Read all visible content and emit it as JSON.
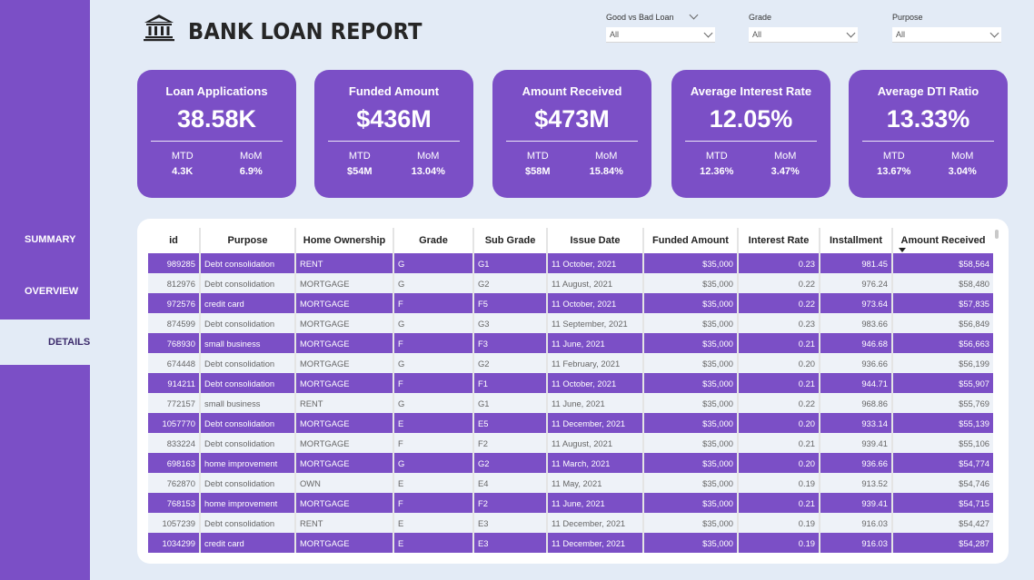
{
  "sidebar": {
    "items": [
      {
        "label": "SUMMARY"
      },
      {
        "label": "OVERVIEW"
      },
      {
        "label": "DETAILS"
      }
    ]
  },
  "header": {
    "title": "BANK LOAN REPORT",
    "icon": "bank-icon"
  },
  "filters": [
    {
      "label": "Good vs Bad Loan",
      "value": "All"
    },
    {
      "label": "Grade",
      "value": "All"
    },
    {
      "label": "Purpose",
      "value": "All"
    }
  ],
  "kpis": [
    {
      "title": "Loan Applications",
      "value": "38.58K",
      "mtd_label": "MTD",
      "mtd": "4.3K",
      "mom_label": "MoM",
      "mom": "6.9%"
    },
    {
      "title": "Funded Amount",
      "value": "$436M",
      "mtd_label": "MTD",
      "mtd": "$54M",
      "mom_label": "MoM",
      "mom": "13.04%"
    },
    {
      "title": "Amount Received",
      "value": "$473M",
      "mtd_label": "MTD",
      "mtd": "$58M",
      "mom_label": "MoM",
      "mom": "15.84%"
    },
    {
      "title": "Average Interest Rate",
      "value": "12.05%",
      "mtd_label": "MTD",
      "mtd": "12.36%",
      "mom_label": "MoM",
      "mom": "3.47%"
    },
    {
      "title": "Average DTI Ratio",
      "value": "13.33%",
      "mtd_label": "MTD",
      "mtd": "13.67%",
      "mom_label": "MoM",
      "mom": "3.04%"
    }
  ],
  "table": {
    "columns": [
      "id",
      "Purpose",
      "Home Ownership",
      "Grade",
      "Sub Grade",
      "Issue Date",
      "Funded Amount",
      "Interest Rate",
      "Installment",
      "Amount Received"
    ],
    "rows": [
      [
        "989285",
        "Debt consolidation",
        "RENT",
        "G",
        "G1",
        "11 October, 2021",
        "$35,000",
        "0.23",
        "981.45",
        "$58,564"
      ],
      [
        "812976",
        "Debt consolidation",
        "MORTGAGE",
        "G",
        "G2",
        "11 August, 2021",
        "$35,000",
        "0.22",
        "976.24",
        "$58,480"
      ],
      [
        "972576",
        "credit card",
        "MORTGAGE",
        "F",
        "F5",
        "11 October, 2021",
        "$35,000",
        "0.22",
        "973.64",
        "$57,835"
      ],
      [
        "874599",
        "Debt consolidation",
        "MORTGAGE",
        "G",
        "G3",
        "11 September, 2021",
        "$35,000",
        "0.23",
        "983.66",
        "$56,849"
      ],
      [
        "768930",
        "small business",
        "MORTGAGE",
        "F",
        "F3",
        "11 June, 2021",
        "$35,000",
        "0.21",
        "946.68",
        "$56,663"
      ],
      [
        "674448",
        "Debt consolidation",
        "MORTGAGE",
        "G",
        "G2",
        "11 February, 2021",
        "$35,000",
        "0.20",
        "936.66",
        "$56,199"
      ],
      [
        "914211",
        "Debt consolidation",
        "MORTGAGE",
        "F",
        "F1",
        "11 October, 2021",
        "$35,000",
        "0.21",
        "944.71",
        "$55,907"
      ],
      [
        "772157",
        "small business",
        "RENT",
        "G",
        "G1",
        "11 June, 2021",
        "$35,000",
        "0.22",
        "968.86",
        "$55,769"
      ],
      [
        "1057770",
        "Debt consolidation",
        "MORTGAGE",
        "E",
        "E5",
        "11 December, 2021",
        "$35,000",
        "0.20",
        "933.14",
        "$55,139"
      ],
      [
        "833224",
        "Debt consolidation",
        "MORTGAGE",
        "F",
        "F2",
        "11 August, 2021",
        "$35,000",
        "0.21",
        "939.41",
        "$55,106"
      ],
      [
        "698163",
        "home improvement",
        "MORTGAGE",
        "G",
        "G2",
        "11 March, 2021",
        "$35,000",
        "0.20",
        "936.66",
        "$54,774"
      ],
      [
        "762870",
        "Debt consolidation",
        "OWN",
        "E",
        "E4",
        "11 May, 2021",
        "$35,000",
        "0.19",
        "913.52",
        "$54,746"
      ],
      [
        "768153",
        "home improvement",
        "MORTGAGE",
        "F",
        "F2",
        "11 June, 2021",
        "$35,000",
        "0.21",
        "939.41",
        "$54,715"
      ],
      [
        "1057239",
        "Debt consolidation",
        "RENT",
        "E",
        "E3",
        "11 December, 2021",
        "$35,000",
        "0.19",
        "916.03",
        "$54,427"
      ],
      [
        "1034299",
        "credit card",
        "MORTGAGE",
        "E",
        "E3",
        "11 December, 2021",
        "$35,000",
        "0.19",
        "916.03",
        "$54,287"
      ]
    ]
  },
  "colors": {
    "accent": "#7b4fc6",
    "background": "#e3ebf6",
    "row_alt": "#eef2f8"
  }
}
